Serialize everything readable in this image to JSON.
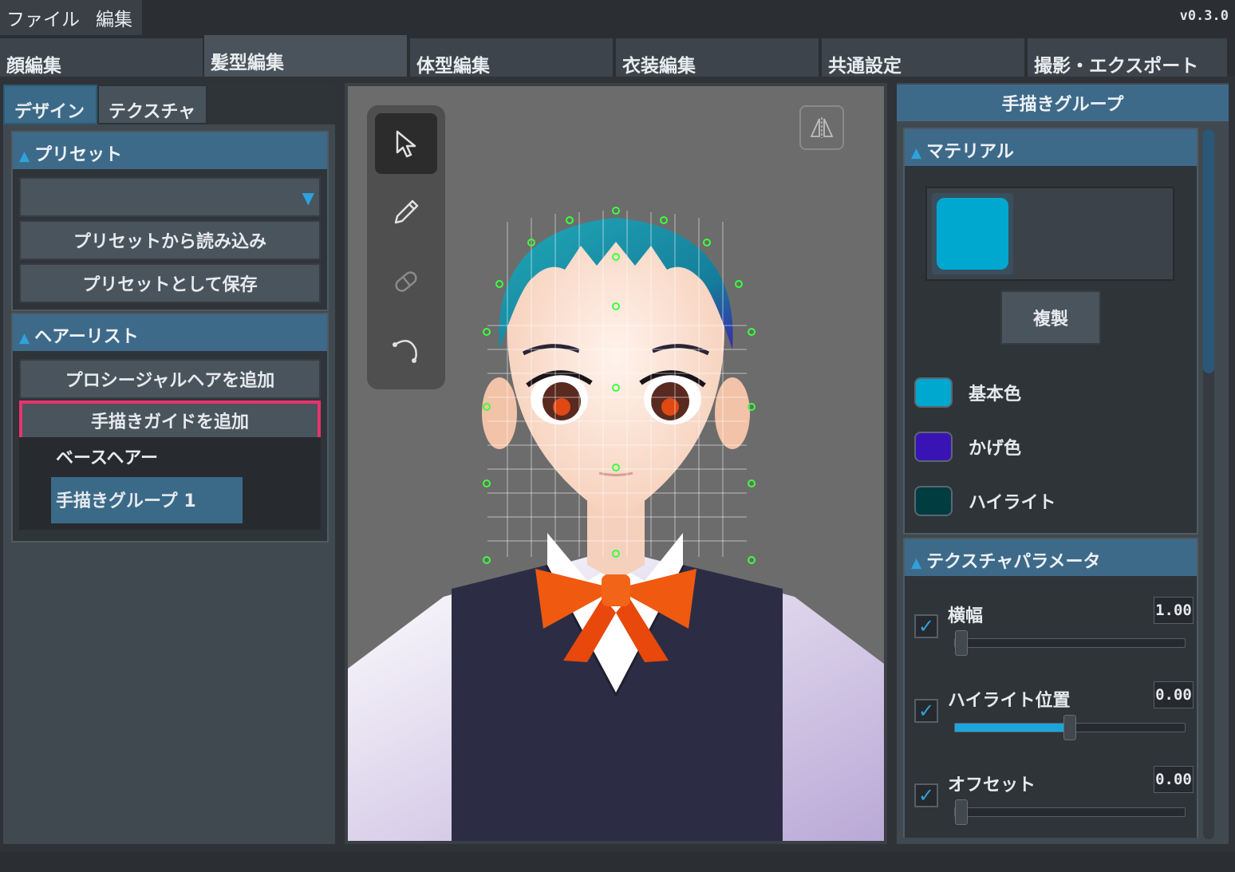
{
  "menu": {
    "file": "ファイル",
    "edit": "編集"
  },
  "version": "v0.3.0",
  "main_tabs": [
    "顔編集",
    "髪型編集",
    "体型編集",
    "衣装編集",
    "共通設定",
    "撮影・エクスポート"
  ],
  "active_main_tab": "髪型編集",
  "sub_tabs": [
    "デザイン",
    "テクスチャ"
  ],
  "active_sub_tab": "デザイン",
  "preset": {
    "header": "プリセット",
    "dropdown_value": "",
    "load_button": "プリセットから読み込み",
    "save_button": "プリセットとして保存"
  },
  "hair_list": {
    "header": "ヘアーリスト",
    "add_procedural_button": "プロシージャルヘアを追加",
    "add_guide_button": "手描きガイドを追加",
    "items": [
      "ベースヘアー",
      "手描きグループ 1"
    ],
    "selected_item": "手描きグループ 1"
  },
  "highlight_color": "#e8336f",
  "viewport": {
    "tools": [
      "select-arrow-icon",
      "pencil-icon",
      "eraser-icon",
      "curve-icon"
    ],
    "active_tool": "select-arrow-icon",
    "mirror_icon": "mirror-icon"
  },
  "right_panel": {
    "title": "手描きグループ",
    "material": {
      "header": "マテリアル",
      "preview_color": "#00a8d0",
      "duplicate_button": "複製",
      "colors": [
        {
          "label": "基本色",
          "color": "#00a8d0"
        },
        {
          "label": "かげ色",
          "color": "#3a13b4"
        },
        {
          "label": "ハイライト",
          "color": "#003c40"
        }
      ]
    },
    "texture_params": {
      "header": "テクスチャパラメータ",
      "params": [
        {
          "label": "横幅",
          "value": "1.00",
          "checked": true,
          "level": 0.0
        },
        {
          "label": "ハイライト位置",
          "value": "0.00",
          "checked": true,
          "level": 0.5
        },
        {
          "label": "オフセット",
          "value": "0.00",
          "checked": true,
          "level": 0.0
        }
      ]
    },
    "scroll_position": 0.0
  }
}
